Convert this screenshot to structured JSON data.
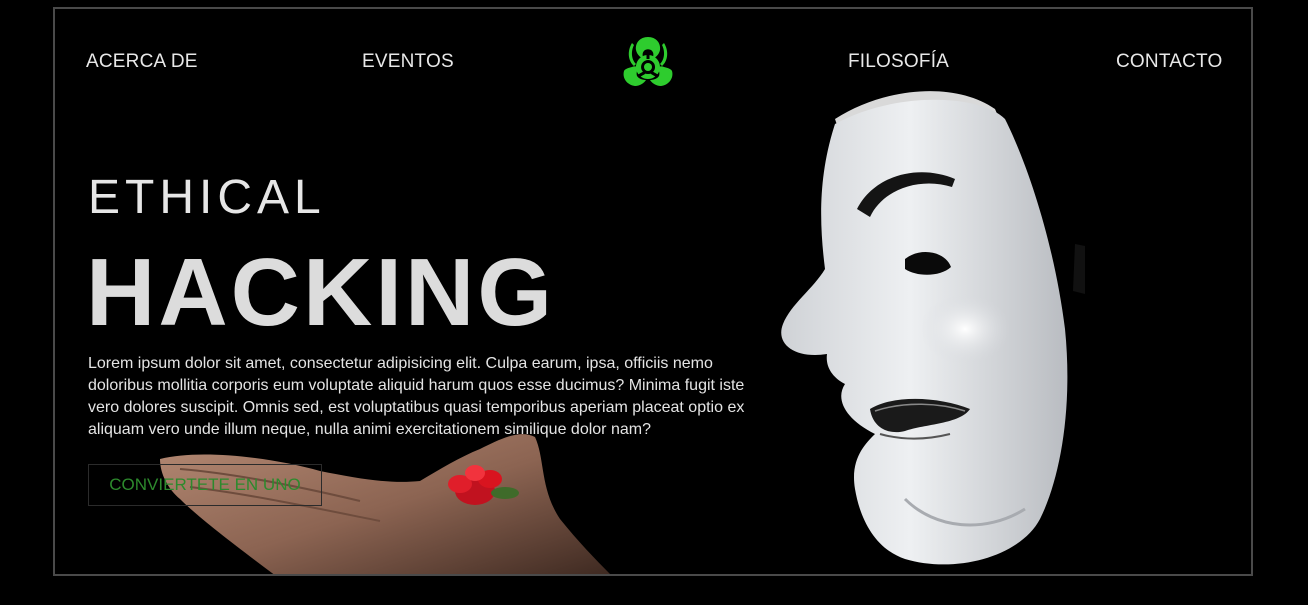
{
  "nav": {
    "about": "ACERCA DE",
    "events": "EVENTOS",
    "philosophy": "FILOSOFÍA",
    "contact": "CONTACTO",
    "logo_icon": "biohazard-icon",
    "logo_color": "#2ecc2e"
  },
  "hero": {
    "kicker": "ETHICAL",
    "title": "HACKING",
    "body": "Lorem ipsum dolor sit amet, consectetur adipisicing elit. Culpa earum, ipsa, officiis nemo doloribus mollitia corporis eum voluptate aliquid harum quos esse ducimus? Minima fugit iste vero dolores suscipit. Omnis sed, est voluptatibus quasi temporibus aperiam placeat optio ex aliquam vero unde illum neque, nulla animi exercitationem similique dolor nam?",
    "cta_label": "CONVIERTETE EN UNO",
    "cta_color": "#2d8a2d"
  },
  "images": {
    "mask": "guy-fawkes-mask-image",
    "hand": "hand-with-red-flower-image"
  }
}
